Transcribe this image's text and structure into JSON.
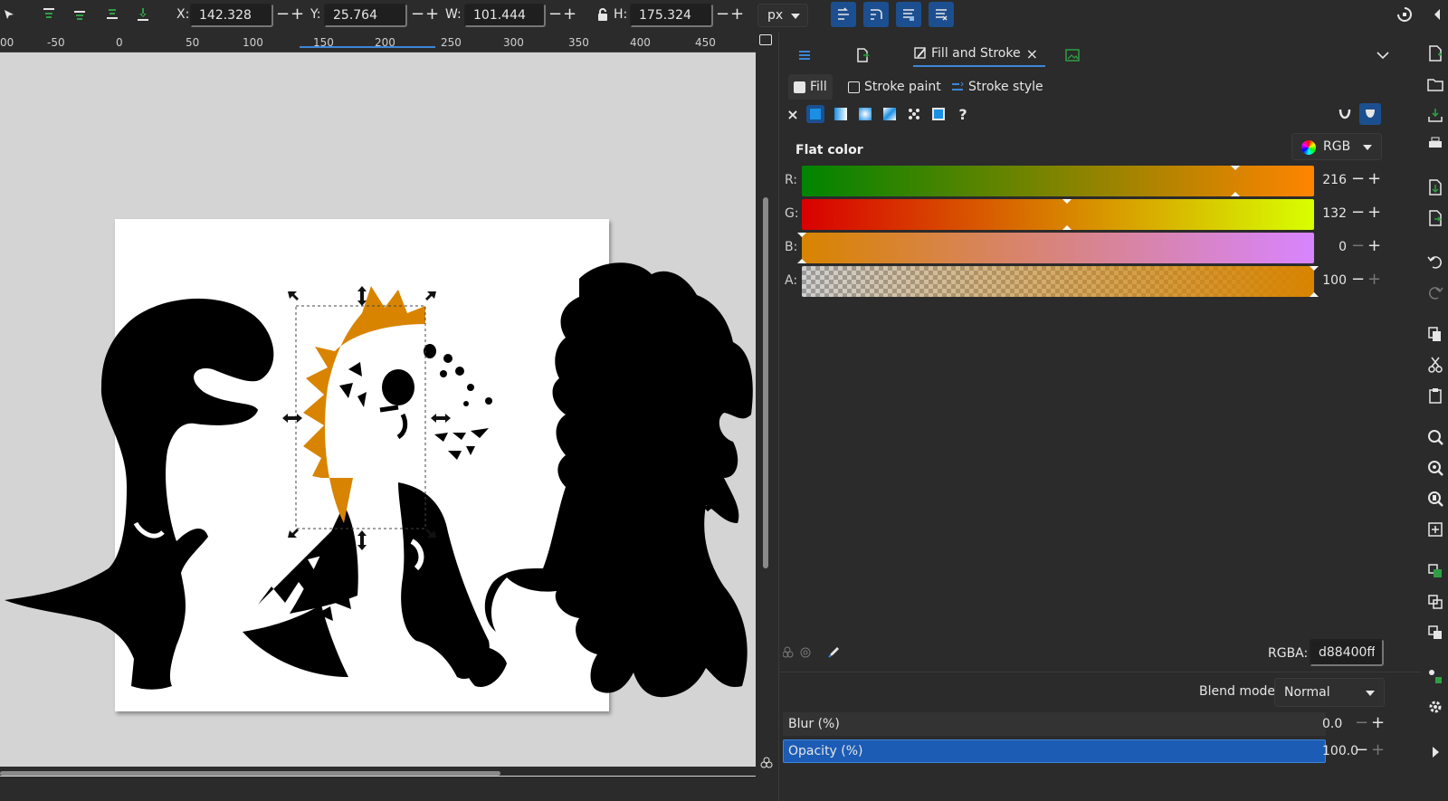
{
  "toolbar": {
    "x_label": "X:",
    "x_value": "142.328",
    "y_label": "Y:",
    "y_value": "25.764",
    "w_label": "W:",
    "w_value": "101.444",
    "h_label": "H:",
    "h_value": "175.324",
    "minus": "−",
    "plus": "+",
    "unit": "px"
  },
  "ruler": {
    "ticks": [
      "00",
      "-50",
      "0",
      "50",
      "100",
      "150",
      "200",
      "250",
      "300",
      "350",
      "400",
      "450"
    ]
  },
  "fill_stroke": {
    "tab_label": "Fill and Stroke",
    "tab_close": "×",
    "sub_tabs": {
      "fill": "Fill",
      "stroke_paint": "Stroke paint",
      "stroke_style": "Stroke style"
    },
    "paint_none": "×",
    "paint_unknown": "?",
    "mode_label": "Flat color",
    "color_model": "RGB",
    "channels": [
      {
        "label": "R:",
        "value": "216",
        "level": 0.847
      },
      {
        "label": "G:",
        "value": "132",
        "level": 0.518
      },
      {
        "label": "B:",
        "value": "0",
        "level": 0
      },
      {
        "label": "A:",
        "value": "100",
        "level": 1
      }
    ],
    "rgba_label": "RGBA:",
    "rgba_value": "d88400ff",
    "blend_label": "Blend mode:",
    "blend_value": "Normal",
    "blur_label": "Blur (%)",
    "blur_value": "0.0",
    "opacity_label": "Opacity (%)",
    "opacity_value": "100.0",
    "minus": "−",
    "plus": "+"
  },
  "colors": {
    "accent": "#1c4f8f",
    "tab_underline": "#3c86d8",
    "fill_color": "#d88400",
    "opacity_bar": "#1c5cb5"
  }
}
